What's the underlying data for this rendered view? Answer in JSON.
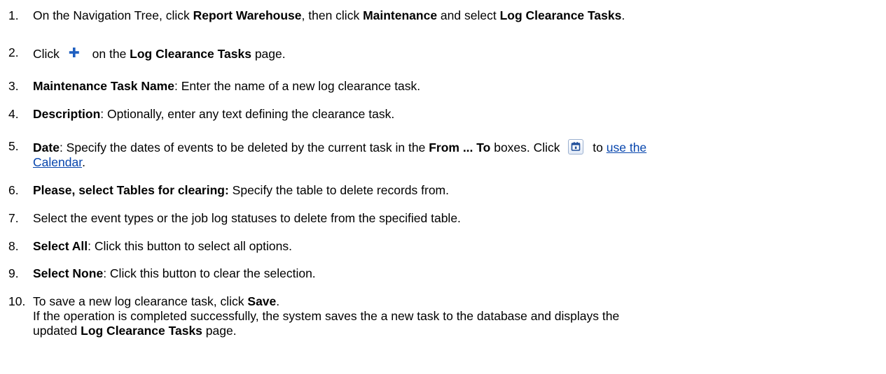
{
  "steps": [
    {
      "num": "1.",
      "parts": [
        {
          "t": "text",
          "v": "On the Navigation Tree, click "
        },
        {
          "t": "bold",
          "v": "Report Warehouse"
        },
        {
          "t": "text",
          "v": ", then click "
        },
        {
          "t": "bold",
          "v": "Maintenance"
        },
        {
          "t": "text",
          "v": " and select "
        },
        {
          "t": "bold",
          "v": "Log Clearance Tasks"
        },
        {
          "t": "text",
          "v": "."
        }
      ]
    },
    {
      "num": "2.",
      "parts": [
        {
          "t": "text",
          "v": "Click "
        },
        {
          "t": "icon",
          "v": "plus-icon"
        },
        {
          "t": "text",
          "v": " on the "
        },
        {
          "t": "bold",
          "v": "Log Clearance Tasks"
        },
        {
          "t": "text",
          "v": " page."
        }
      ]
    },
    {
      "num": "3.",
      "parts": [
        {
          "t": "bold",
          "v": "Maintenance Task Name"
        },
        {
          "t": "text",
          "v": ": Enter the name of a new log clearance task."
        }
      ]
    },
    {
      "num": "4.",
      "parts": [
        {
          "t": "bold",
          "v": "Description"
        },
        {
          "t": "text",
          "v": ": Optionally, enter any text defining the clearance task."
        }
      ]
    },
    {
      "num": "5.",
      "parts": [
        {
          "t": "bold",
          "v": "Date"
        },
        {
          "t": "text",
          "v": ": Specify the dates of events to be deleted by the current task in the "
        },
        {
          "t": "bold",
          "v": "From ... To"
        },
        {
          "t": "text",
          "v": " boxes. Click "
        },
        {
          "t": "icon",
          "v": "calendar-icon"
        },
        {
          "t": "text",
          "v": " to "
        },
        {
          "t": "link",
          "v": "use the"
        },
        {
          "t": "br"
        },
        {
          "t": "link",
          "v": "Calendar"
        },
        {
          "t": "text",
          "v": "."
        }
      ]
    },
    {
      "num": "6.",
      "parts": [
        {
          "t": "bold",
          "v": "Please, select Tables for clearing:"
        },
        {
          "t": "text",
          "v": " Specify the table to delete records from."
        }
      ]
    },
    {
      "num": "7.",
      "parts": [
        {
          "t": "text",
          "v": "Select the event types or the job log statuses to delete from the specified table."
        }
      ]
    },
    {
      "num": "8.",
      "parts": [
        {
          "t": "bold",
          "v": "Select All"
        },
        {
          "t": "text",
          "v": ": Click this button to select all options."
        }
      ]
    },
    {
      "num": "9.",
      "parts": [
        {
          "t": "bold",
          "v": "Select None"
        },
        {
          "t": "text",
          "v": ": Click this button to clear the selection."
        }
      ]
    },
    {
      "num": "10.",
      "parts": [
        {
          "t": "text",
          "v": "To save a new log clearance task, click "
        },
        {
          "t": "bold",
          "v": "Save"
        },
        {
          "t": "text",
          "v": "."
        },
        {
          "t": "br"
        },
        {
          "t": "text",
          "v": "If the operation is completed successfully, the system saves the a new task to the database and displays the"
        },
        {
          "t": "br"
        },
        {
          "t": "text",
          "v": "updated "
        },
        {
          "t": "bold",
          "v": "Log Clearance Tasks"
        },
        {
          "t": "text",
          "v": " page."
        }
      ]
    }
  ]
}
